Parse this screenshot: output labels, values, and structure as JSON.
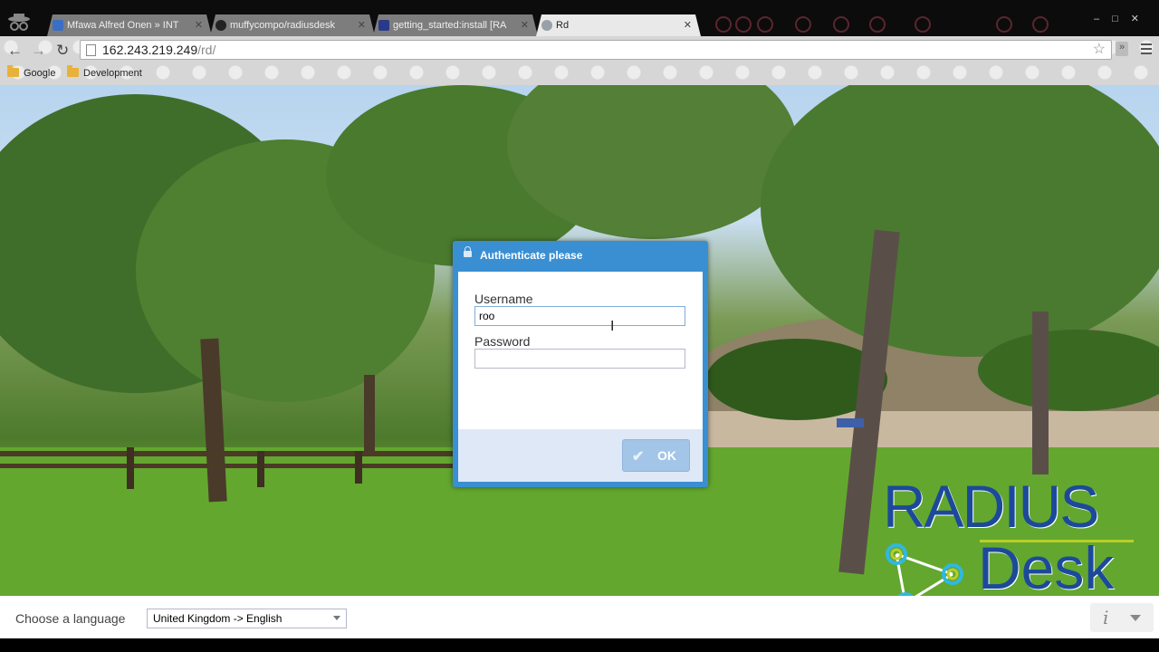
{
  "browser": {
    "tabs": [
      {
        "title": "Mfawa Alfred Onen » INT",
        "favicon_color": "#3a6fc4",
        "active": false
      },
      {
        "title": "muffycompo/radiusdesk",
        "favicon_color": "#222222",
        "active": false
      },
      {
        "title": "getting_started:install [RA",
        "favicon_color": "#2a3a8a",
        "active": false
      },
      {
        "title": "Rd",
        "favicon_color": "#9aa0a8",
        "active": true
      }
    ],
    "tab_close_glyph": "✕",
    "window_controls": "‒□✕",
    "nav": {
      "back_glyph": "←",
      "forward_glyph": "→",
      "reload_glyph": "↻"
    },
    "address": {
      "host": "162.243.219.249",
      "path": "/rd/"
    },
    "star_glyph": "☆",
    "ext_glyph": "»",
    "bookmarks": [
      "Google",
      "Development"
    ]
  },
  "dialog": {
    "title": "Authenticate please",
    "username_label": "Username",
    "username_value": "roo",
    "password_label": "Password",
    "password_value": "",
    "ok_label": "OK",
    "ok_glyph": "✔"
  },
  "cursor_glyph": "I",
  "logo": {
    "line1": "RADIUS",
    "line2": "Desk",
    "primary_color": "#1c4a9a",
    "accent_color": "#b7cf2b",
    "node_color": "#2fb8e0"
  },
  "footer": {
    "language_label": "Choose a language",
    "language_value": "United Kingdom -> English",
    "info_glyph": "i"
  },
  "icons": {
    "incognito": "incognito-icon",
    "lock": "lock-icon",
    "check": "check-icon",
    "info": "info-icon",
    "star": "star-icon",
    "menu": "menu-icon",
    "folder": "folder-icon"
  }
}
